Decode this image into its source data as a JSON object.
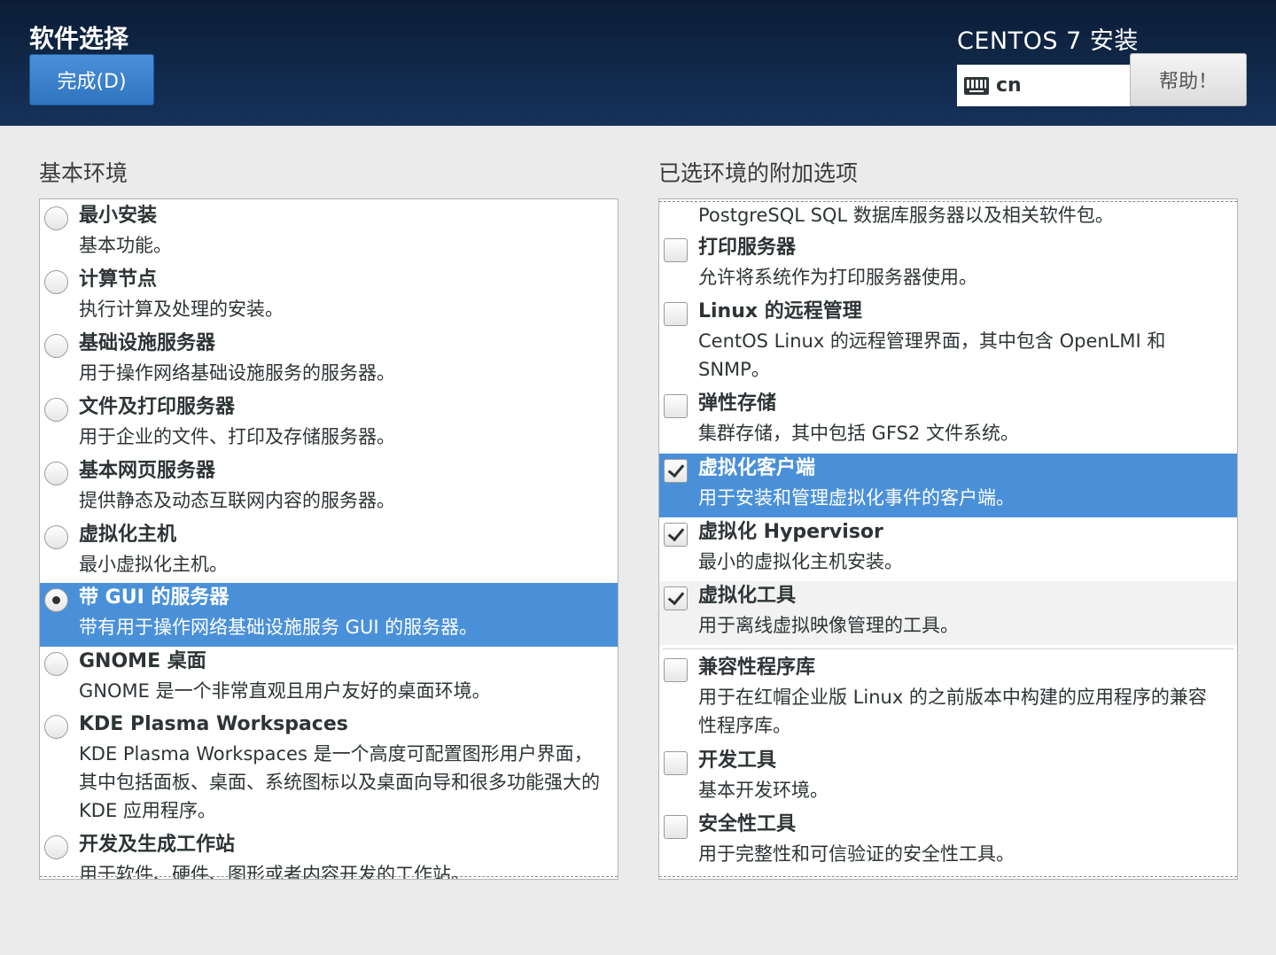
{
  "header": {
    "page_title": "软件选择",
    "done_label": "完成(D)",
    "product_title": "CENTOS 7 安装",
    "keyboard_layout": "cn",
    "help_label": "帮助！",
    "accent_color": "#4a90d9",
    "header_color": "#102a4c"
  },
  "base_env": {
    "heading": "基本环境",
    "items": [
      {
        "title": "最小安装",
        "desc": "基本功能。",
        "selected": false
      },
      {
        "title": "计算节点",
        "desc": "执行计算及处理的安装。",
        "selected": false
      },
      {
        "title": "基础设施服务器",
        "desc": "用于操作网络基础设施服务的服务器。",
        "selected": false
      },
      {
        "title": "文件及打印服务器",
        "desc": "用于企业的文件、打印及存储服务器。",
        "selected": false
      },
      {
        "title": "基本网页服务器",
        "desc": "提供静态及动态互联网内容的服务器。",
        "selected": false
      },
      {
        "title": "虚拟化主机",
        "desc": "最小虚拟化主机。",
        "selected": false
      },
      {
        "title": "带 GUI 的服务器",
        "desc": "带有用于操作网络基础设施服务 GUI 的服务器。",
        "selected": true
      },
      {
        "title": "GNOME 桌面",
        "desc": "GNOME 是一个非常直观且用户友好的桌面环境。",
        "selected": false
      },
      {
        "title": "KDE Plasma Workspaces",
        "desc": "KDE Plasma Workspaces 是一个高度可配置图形用户界面，其中包括面板、桌面、系统图标以及桌面向导和很多功能强大的 KDE 应用程序。",
        "selected": false
      },
      {
        "title": "开发及生成工作站",
        "desc": "用于软件、硬件、图形或者内容开发的工作站。",
        "selected": false
      }
    ]
  },
  "addons": {
    "heading": "已选环境的附加选项",
    "partial_desc": "PostgreSQL SQL 数据库服务器以及相关软件包。",
    "items": [
      {
        "title": "打印服务器",
        "desc": "允许将系统作为打印服务器使用。",
        "checked": false
      },
      {
        "title": "Linux 的远程管理",
        "desc": "CentOS Linux 的远程管理界面，其中包含 OpenLMI 和 SNMP。",
        "checked": false
      },
      {
        "title": "弹性存储",
        "desc": "集群存储，其中包括 GFS2 文件系统。",
        "checked": false
      },
      {
        "title": "虚拟化客户端",
        "desc": "用于安装和管理虚拟化事件的客户端。",
        "checked": true
      },
      {
        "title": "虚拟化 Hypervisor",
        "desc": "最小的虚拟化主机安装。",
        "checked": true
      },
      {
        "title": "虚拟化工具",
        "desc": "用于离线虚拟映像管理的工具。",
        "checked": true
      },
      {
        "title": "兼容性程序库",
        "desc": "用于在红帽企业版 Linux 的之前版本中构建的应用程序的兼容性程序库。",
        "checked": false
      },
      {
        "title": "开发工具",
        "desc": "基本开发环境。",
        "checked": false
      },
      {
        "title": "安全性工具",
        "desc": "用于完整性和可信验证的安全性工具。",
        "checked": false
      }
    ]
  }
}
